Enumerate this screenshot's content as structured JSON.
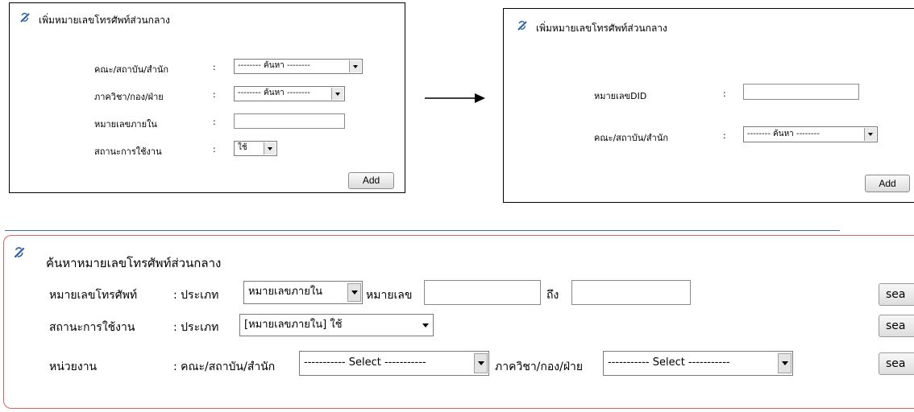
{
  "panel_left": {
    "title": "เพิ่มหมายเลขโทรศัพท์ส่วนกลาง",
    "rows": [
      {
        "label": "คณะ/สถาบัน/สำนัก",
        "colon": ":",
        "value": "-------- ค้นหา --------"
      },
      {
        "label": "ภาควิชา/กอง/ฝ่าย",
        "colon": ":",
        "value": "-------- ค้นหา --------"
      },
      {
        "label": "หมายเลขภายใน",
        "colon": ":",
        "value": ""
      },
      {
        "label": "สถานะการใช้งาน",
        "colon": ":",
        "value": "ใช้"
      }
    ],
    "add_label": "Add"
  },
  "panel_right": {
    "title": "เพิ่มหมายเลขโทรศัพท์ส่วนกลาง",
    "rows": [
      {
        "label": "หมายเลขDID",
        "colon": ":",
        "value": ""
      },
      {
        "label": "คณะ/สถาบัน/สำนัก",
        "colon": ":",
        "value": "-------- ค้นหา --------"
      }
    ],
    "add_label": "Add"
  },
  "search_panel": {
    "title": "ค้นหาหมายเลขโทรศัพท์ส่วนกลาง",
    "row1": {
      "label": "หมายเลขโทรศัพท์",
      "type_label": ": ประเภท",
      "type_value": "หมายเลขภายใน",
      "number_label": "หมายเลข",
      "to_label": "ถึง",
      "button": "sea"
    },
    "row2": {
      "label": "สถานะการใช้งาน",
      "type_label": ": ประเภท",
      "type_value": "[หมายเลขภายใน] ใช้",
      "button": "sea"
    },
    "row3": {
      "label": "หน่วยงาน",
      "faculty_label": ": คณะ/สถาบัน/สำนัก",
      "faculty_value": "----------- Select -----------",
      "dept_label": "ภาควิชา/กอง/ฝ่าย",
      "dept_value": "----------- Select -----------",
      "button": "sea"
    }
  },
  "colors": {
    "search_border": "#e06060",
    "divider": "#3c6fa8",
    "icon": "#2a5fa8"
  }
}
